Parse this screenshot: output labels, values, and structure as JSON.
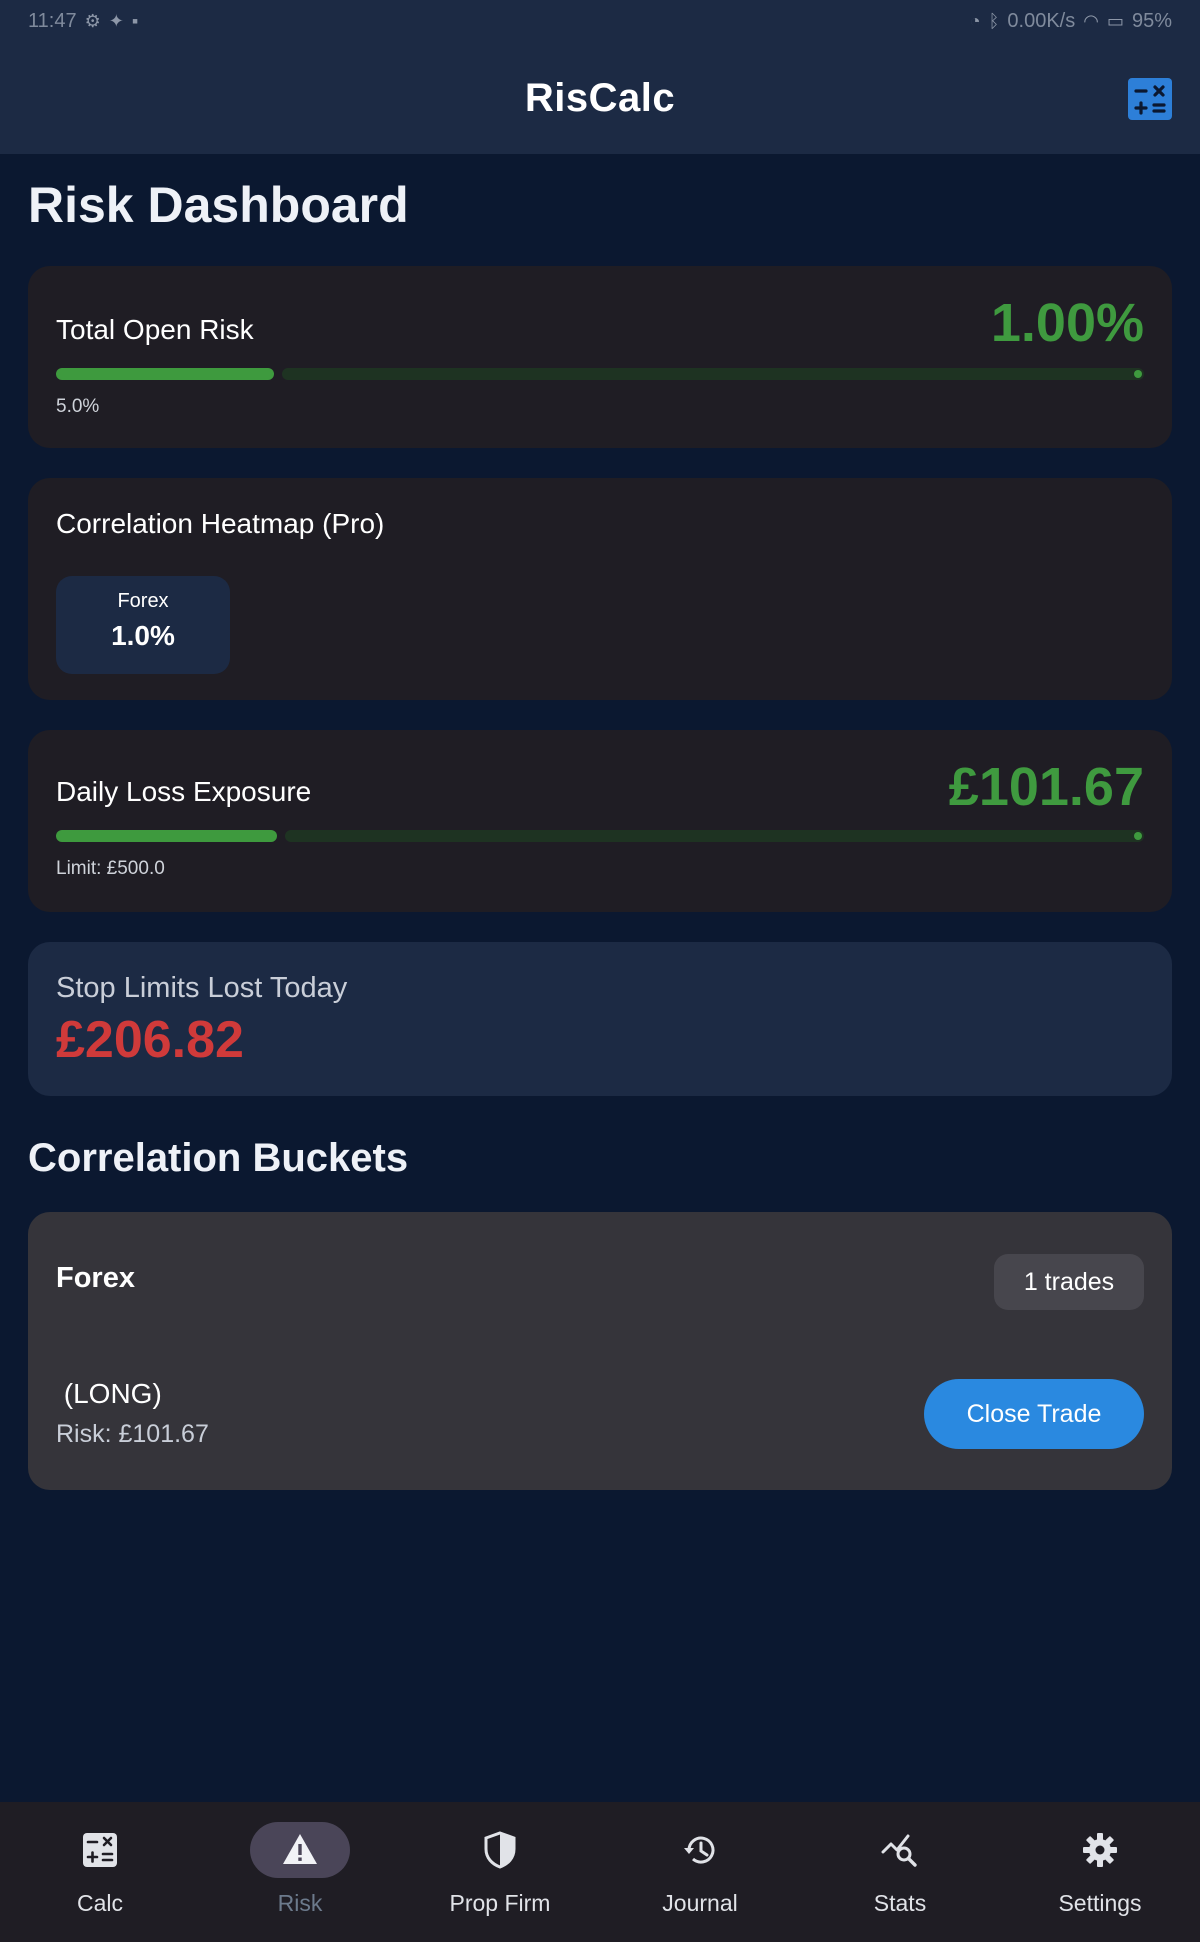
{
  "status_bar": {
    "time": "11:47",
    "network_speed": "0.00K/s",
    "battery": "95%"
  },
  "app_bar": {
    "title": "RisCalc",
    "action_icon": "calculator-icon"
  },
  "page_title": "Risk Dashboard",
  "total_open_risk": {
    "label": "Total Open Risk",
    "value": "1.00%",
    "limit_text": "5.0%",
    "progress": 0.2
  },
  "heatmap": {
    "title": "Correlation Heatmap (Pro)",
    "chips": [
      {
        "name": "Forex",
        "value": "1.0%"
      }
    ]
  },
  "daily_loss": {
    "label": "Daily Loss Exposure",
    "value": "£101.67",
    "limit_text": "Limit: £500.0",
    "progress": 0.203
  },
  "stop_limits": {
    "label": "Stop Limits Lost Today",
    "value": "£206.82"
  },
  "buckets_title": "Correlation Buckets",
  "buckets": [
    {
      "name": "Forex",
      "trades_badge": "1 trades",
      "trade_direction": " (LONG)",
      "trade_risk": "Risk: £101.67",
      "close_label": "Close Trade"
    }
  ],
  "nav": {
    "items": [
      {
        "label": "Calc",
        "icon": "calculator-icon"
      },
      {
        "label": "Risk",
        "icon": "warning-icon",
        "active": true
      },
      {
        "label": "Prop Firm",
        "icon": "shield-icon"
      },
      {
        "label": "Journal",
        "icon": "history-icon"
      },
      {
        "label": "Stats",
        "icon": "chart-search-icon"
      },
      {
        "label": "Settings",
        "icon": "gear-icon"
      }
    ]
  },
  "colors": {
    "background": "#0b1830",
    "card": "#1f1d24",
    "accent_blue": "#2a89e0",
    "positive_green": "#3f9a3f",
    "negative_red": "#d03a3a"
  }
}
